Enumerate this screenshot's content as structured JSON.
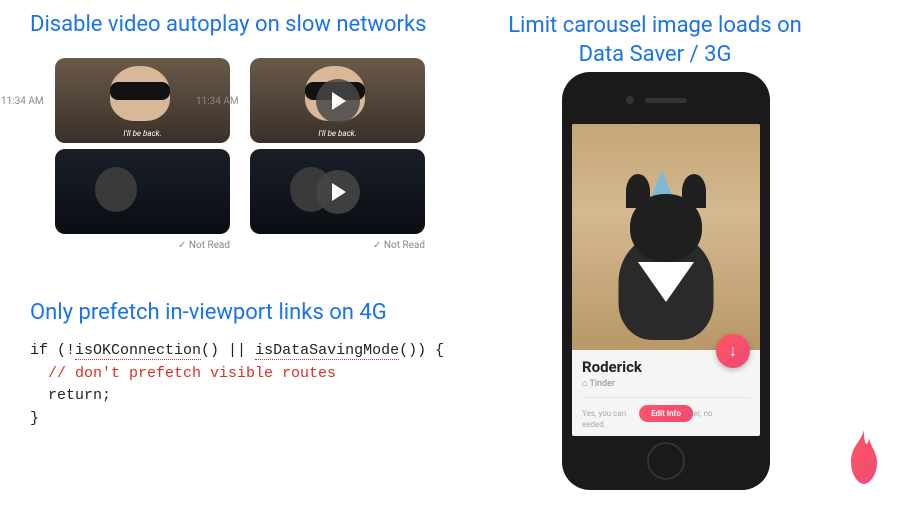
{
  "headings": {
    "autoplay": "Disable video autoplay on slow networks",
    "carousel": "Limit carousel image loads on Data Saver / 3G",
    "prefetch": "Only prefetch in-viewport links on 4G"
  },
  "video": {
    "timestamp": "11:34 AM",
    "caption": "I'll be back.",
    "not_read": "Not Read"
  },
  "code": {
    "line1_a": "if (!",
    "line1_b": "isOKConnection",
    "line1_c": "() || ",
    "line1_d": "isDataSavingMode",
    "line1_e": "()) {",
    "line2": "// don't prefetch visible routes",
    "line3": "return;",
    "line4": "}"
  },
  "phone": {
    "name": "Roderick",
    "subtitle": "Tinder",
    "desc_a": "Yes, you can",
    "desc_b": "in your browser, no",
    "desc_c": "eeded.",
    "edit": "Edit Info",
    "fab": "↓"
  }
}
